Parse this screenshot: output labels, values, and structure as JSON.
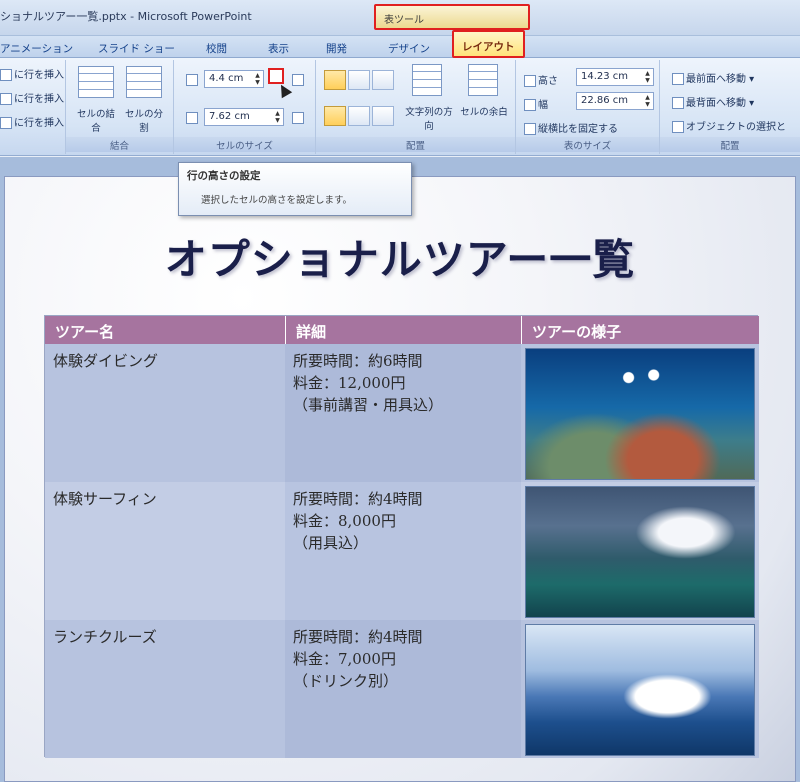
{
  "window": {
    "title": "ショナルツアー一覧.pptx - Microsoft PowerPoint",
    "context_tab_group": "表ツール"
  },
  "tabs": [
    {
      "label": "アニメーション"
    },
    {
      "label": "スライド ショー"
    },
    {
      "label": "校閲"
    },
    {
      "label": "表示"
    },
    {
      "label": "開発"
    },
    {
      "label": "デザイン"
    },
    {
      "label": "レイアウト",
      "active": true
    }
  ],
  "ribbon": {
    "rows_cols": {
      "items": [
        "に行を挿入",
        "に行を挿入",
        "に行を挿入"
      ]
    },
    "merge": {
      "label": "結合",
      "merge_cells": "セルの結合",
      "split_cells": "セルの分割"
    },
    "cell_size": {
      "label": "セルのサイズ",
      "height_value": "4.4 cm",
      "width_value": "7.62 cm"
    },
    "alignment": {
      "label": "配置",
      "text_direction": "文字列の方向",
      "cell_margins": "セルの余白"
    },
    "table_size": {
      "label": "表のサイズ",
      "height_label": "高さ",
      "height_value": "14.23 cm",
      "width_label": "幅",
      "width_value": "22.86 cm",
      "lock_aspect": "縦横比を固定する"
    },
    "arrange": {
      "label": "配置",
      "bring_front": "最前面へ移動",
      "send_back": "最背面へ移動",
      "selection_pane": "オブジェクトの選択と"
    }
  },
  "tooltip": {
    "title": "行の高さの設定",
    "body": "選択したセルの高さを設定します。"
  },
  "slide": {
    "title": "オプショナルツアー一覧",
    "table": {
      "headers": [
        "ツアー名",
        "詳細",
        "ツアーの様子"
      ],
      "rows": [
        {
          "name": "体験ダイビング",
          "details": [
            "所要時間：約6時間",
            "料金：12,000円",
            "（事前講習・用具込）"
          ],
          "photo": "diving-photo"
        },
        {
          "name": "体験サーフィン",
          "details": [
            "所要時間：約4時間",
            "料金：8,000円",
            "（用具込）"
          ],
          "photo": "surfing-photo"
        },
        {
          "name": "ランチクルーズ",
          "details": [
            "所要時間：約4時間",
            "料金：7,000円",
            "（ドリンク別）"
          ],
          "photo": "cruise-photo"
        }
      ]
    }
  },
  "colors": {
    "header_purple": "#a6749f",
    "row_light": "#b9c5e0",
    "row_mid": "#aebbda",
    "highlight_red": "#e02020"
  }
}
